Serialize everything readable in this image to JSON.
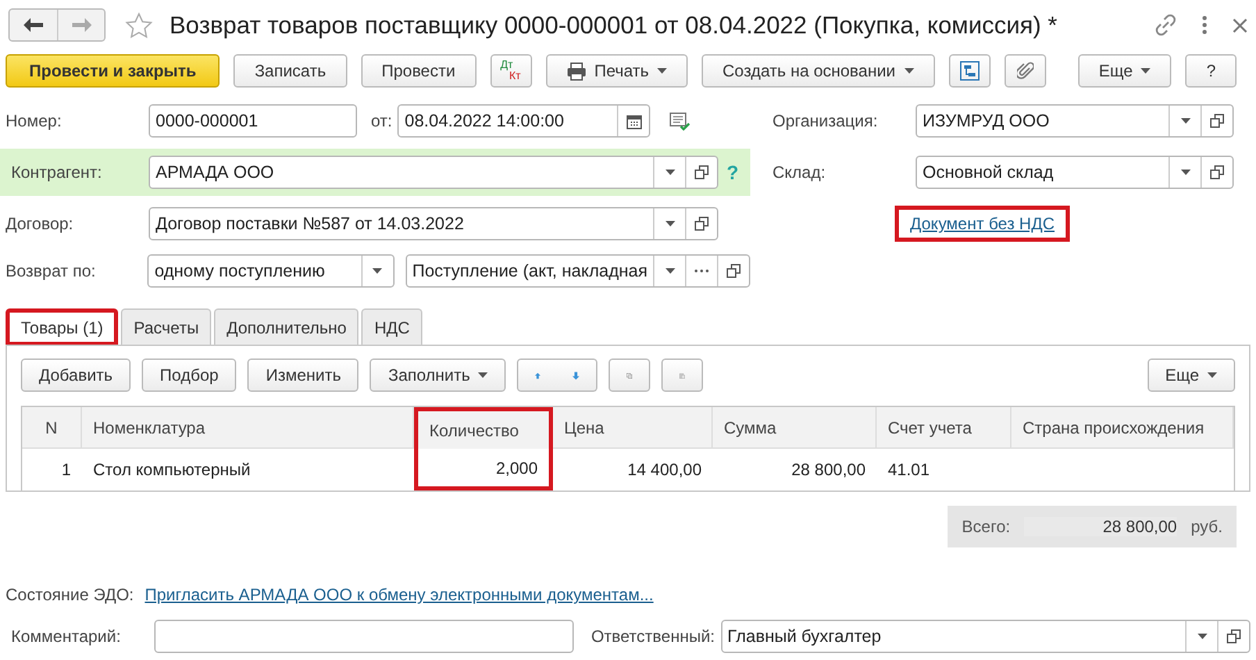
{
  "window": {
    "title": "Возврат товаров поставщику 0000-000001 от 08.04.2022 (Покупка, комиссия) *"
  },
  "toolbar": [
    {
      "kind": "primary",
      "label": "Провести и закрыть"
    },
    {
      "kind": "button",
      "label": "Записать"
    },
    {
      "kind": "button",
      "label": "Провести"
    },
    {
      "kind": "dtkt",
      "top": "Дт",
      "bottom": "Кт"
    },
    {
      "kind": "print",
      "label": "Печать"
    },
    {
      "kind": "dropdown",
      "label": "Создать на основании"
    },
    {
      "kind": "structure"
    },
    {
      "kind": "attach"
    },
    {
      "kind": "dropdown",
      "label": "Еще"
    },
    {
      "kind": "button",
      "label": "?"
    }
  ],
  "form": {
    "number": {
      "label": "Номер:",
      "value": "0000-000001"
    },
    "date": {
      "label": "от:",
      "value": "08.04.2022 14:00:00"
    },
    "counterparty": {
      "label": "Контрагент:",
      "value": "АРМАДА ООО",
      "help": "?"
    },
    "contract": {
      "label": "Договор:",
      "value": "Договор поставки №587 от 14.03.2022"
    },
    "return_by": {
      "label": "Возврат по:",
      "value": "одному поступлению",
      "document": "Поступление (акт, накладная"
    },
    "organization": {
      "label": "Организация:",
      "value": "ИЗУМРУД ООО"
    },
    "warehouse": {
      "label": "Склад:",
      "value": "Основной склад"
    },
    "vat_link": {
      "text": "Документ без НДС",
      "highlighted": true
    }
  },
  "tabs": [
    {
      "label": "Товары (1)",
      "selected": true,
      "highlighted": true
    },
    {
      "label": "Расчеты",
      "selected": false,
      "highlighted": false
    },
    {
      "label": "Дополнительно",
      "selected": false,
      "highlighted": false
    },
    {
      "label": "НДС",
      "selected": false,
      "highlighted": false
    }
  ],
  "table_toolbar": [
    {
      "kind": "button",
      "label": "Добавить"
    },
    {
      "kind": "button",
      "label": "Подбор"
    },
    {
      "kind": "button",
      "label": "Изменить"
    },
    {
      "kind": "dropdown",
      "label": "Заполнить"
    },
    {
      "kind": "up"
    },
    {
      "kind": "down"
    },
    {
      "kind": "copy"
    },
    {
      "kind": "paste"
    }
  ],
  "table_more": "Еще",
  "table": {
    "columns": [
      {
        "label": "N",
        "highlighted": false
      },
      {
        "label": "Номенклатура",
        "highlighted": false
      },
      {
        "label": "Количество",
        "highlighted": true
      },
      {
        "label": "Цена",
        "highlighted": false
      },
      {
        "label": "Сумма",
        "highlighted": false
      },
      {
        "label": "Счет учета",
        "highlighted": false
      },
      {
        "label": "Страна происхождения",
        "highlighted": false
      }
    ],
    "rows": [
      [
        "1",
        "Стол компьютерный",
        "2,000",
        "14 400,00",
        "28 800,00",
        "41.01",
        ""
      ]
    ]
  },
  "total": {
    "label": "Всего:",
    "value": "28 800,00",
    "currency": "руб."
  },
  "edo": {
    "label": "Состояние ЭДО:",
    "link": "Пригласить АРМАДА ООО к обмену электронными документам..."
  },
  "comment": {
    "label": "Комментарий:"
  },
  "responsible": {
    "label": "Ответственный:",
    "value": "Главный бухгалтер"
  }
}
